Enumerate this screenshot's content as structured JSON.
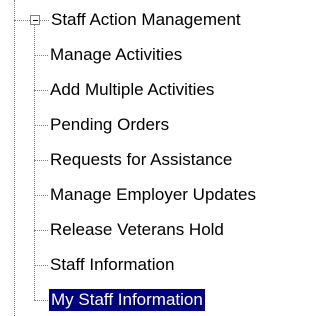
{
  "tree": {
    "parent": {
      "label": "Staff Action Management",
      "expander_icon": "minus-box-icon",
      "expanded": true
    },
    "children": [
      {
        "label": "Manage Activities"
      },
      {
        "label": "Add Multiple Activities"
      },
      {
        "label": "Pending Orders"
      },
      {
        "label": "Requests for Assistance"
      },
      {
        "label": "Manage Employer Updates"
      },
      {
        "label": "Release Veterans Hold"
      },
      {
        "label": "Staff Information"
      },
      {
        "label": "My Staff Information",
        "selected": true
      }
    ],
    "colors": {
      "selection_background": "#000080",
      "selection_text": "#ffffff",
      "connector_line": "#808080"
    }
  }
}
